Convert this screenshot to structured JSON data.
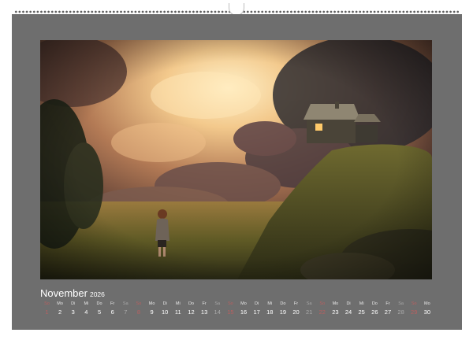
{
  "calendar": {
    "month": "November",
    "year": "2026",
    "days": [
      {
        "wd": "So",
        "num": "1",
        "type": "sunday"
      },
      {
        "wd": "Mo",
        "num": "2",
        "type": "weekday"
      },
      {
        "wd": "Di",
        "num": "3",
        "type": "weekday"
      },
      {
        "wd": "Mi",
        "num": "4",
        "type": "weekday"
      },
      {
        "wd": "Do",
        "num": "5",
        "type": "weekday"
      },
      {
        "wd": "Fr",
        "num": "6",
        "type": "weekday"
      },
      {
        "wd": "Sa",
        "num": "7",
        "type": "weekend"
      },
      {
        "wd": "So",
        "num": "8",
        "type": "sunday"
      },
      {
        "wd": "Mo",
        "num": "9",
        "type": "weekday"
      },
      {
        "wd": "Di",
        "num": "10",
        "type": "weekday"
      },
      {
        "wd": "Mi",
        "num": "11",
        "type": "weekday"
      },
      {
        "wd": "Do",
        "num": "12",
        "type": "weekday"
      },
      {
        "wd": "Fr",
        "num": "13",
        "type": "weekday"
      },
      {
        "wd": "Sa",
        "num": "14",
        "type": "weekend"
      },
      {
        "wd": "So",
        "num": "15",
        "type": "sunday"
      },
      {
        "wd": "Mo",
        "num": "16",
        "type": "weekday"
      },
      {
        "wd": "Di",
        "num": "17",
        "type": "weekday"
      },
      {
        "wd": "Mi",
        "num": "18",
        "type": "weekday"
      },
      {
        "wd": "Do",
        "num": "19",
        "type": "weekday"
      },
      {
        "wd": "Fr",
        "num": "20",
        "type": "weekday"
      },
      {
        "wd": "Sa",
        "num": "21",
        "type": "weekend"
      },
      {
        "wd": "So",
        "num": "22",
        "type": "sunday"
      },
      {
        "wd": "Mo",
        "num": "23",
        "type": "weekday"
      },
      {
        "wd": "Di",
        "num": "24",
        "type": "weekday"
      },
      {
        "wd": "Mi",
        "num": "25",
        "type": "weekday"
      },
      {
        "wd": "Do",
        "num": "26",
        "type": "weekday"
      },
      {
        "wd": "Fr",
        "num": "27",
        "type": "weekday"
      },
      {
        "wd": "Sa",
        "num": "28",
        "type": "weekend"
      },
      {
        "wd": "So",
        "num": "29",
        "type": "sunday"
      },
      {
        "wd": "Mo",
        "num": "30",
        "type": "weekday"
      }
    ]
  },
  "colors": {
    "page_background": "#6e6e6e",
    "sunday": "#b86060",
    "saturday": "#a9a9a9",
    "text": "#ffffff"
  }
}
